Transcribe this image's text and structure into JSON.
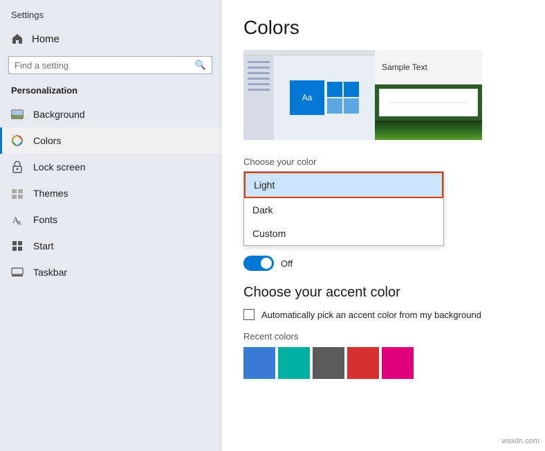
{
  "window": {
    "title": "Settings"
  },
  "sidebar": {
    "title": "Settings",
    "home_label": "Home",
    "search_placeholder": "Find a setting",
    "section_label": "Personalization",
    "items": [
      {
        "id": "background",
        "label": "Background",
        "icon": "background-icon"
      },
      {
        "id": "colors",
        "label": "Colors",
        "icon": "colors-icon",
        "active": true
      },
      {
        "id": "lock-screen",
        "label": "Lock screen",
        "icon": "lock-icon"
      },
      {
        "id": "themes",
        "label": "Themes",
        "icon": "themes-icon"
      },
      {
        "id": "fonts",
        "label": "Fonts",
        "icon": "fonts-icon"
      },
      {
        "id": "start",
        "label": "Start",
        "icon": "start-icon"
      },
      {
        "id": "taskbar",
        "label": "Taskbar",
        "icon": "taskbar-icon"
      }
    ]
  },
  "main": {
    "page_title": "Colors",
    "preview": {
      "sample_text": "Sample Text"
    },
    "choose_color": {
      "label": "Choose your color",
      "options": [
        {
          "id": "light",
          "label": "Light",
          "selected": true
        },
        {
          "id": "dark",
          "label": "Dark"
        },
        {
          "id": "custom",
          "label": "Custom"
        }
      ]
    },
    "toggle": {
      "label": "Off",
      "state": "on"
    },
    "accent_section": {
      "title": "Choose your accent color",
      "checkbox_label": "Automatically pick an accent color from my background"
    },
    "recent_colors": {
      "label": "Recent colors",
      "swatches": [
        {
          "id": "blue",
          "color": "#3a7bd5"
        },
        {
          "id": "teal",
          "color": "#00b0a0"
        },
        {
          "id": "gray",
          "color": "#5a5a5a"
        },
        {
          "id": "red",
          "color": "#d43030"
        },
        {
          "id": "pink",
          "color": "#e0007a"
        }
      ]
    }
  },
  "watermark": "wsxdn.com"
}
